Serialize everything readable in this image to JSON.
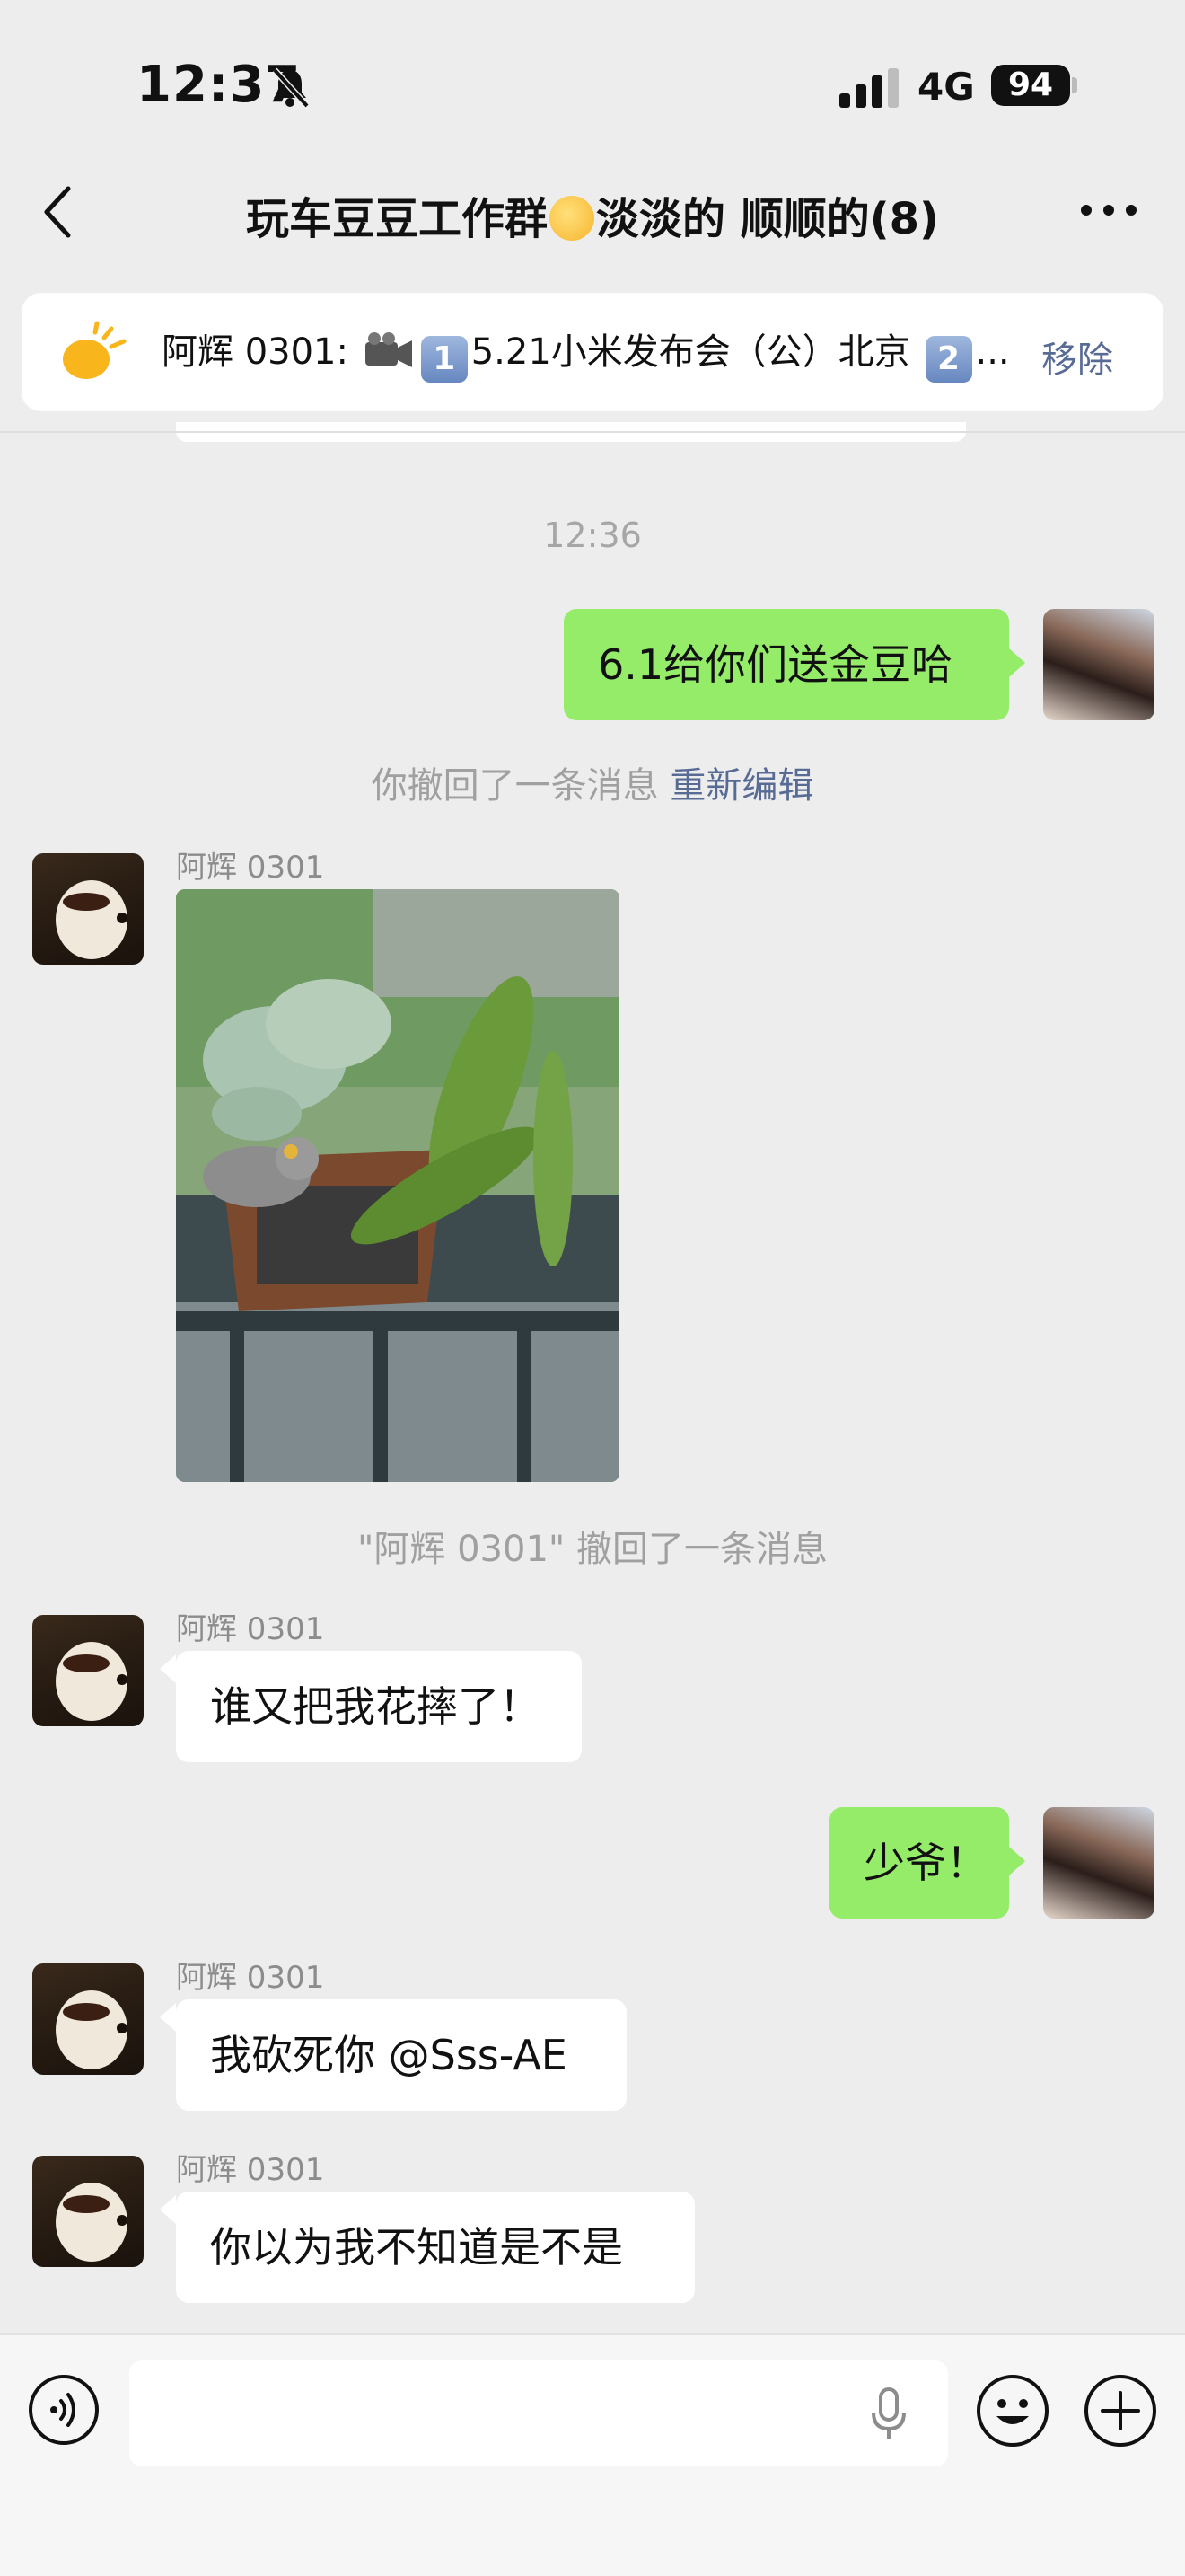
{
  "status_bar": {
    "time": "12:37",
    "network": "4G",
    "battery": "94",
    "icons": [
      "bell-slash-icon",
      "signal-bars-icon"
    ]
  },
  "header": {
    "title_part1": "玩车豆豆工作群",
    "title_part2": "淡淡的 顺顺的",
    "member_count": "(8)",
    "icons": [
      "chevron-left-icon",
      "sun-face-emoji",
      "more-dots-icon"
    ]
  },
  "pinned": {
    "sender": "阿辉 0301:",
    "badge1": "1",
    "text1": "5.21小米发布会（公）北京",
    "badge2": "2",
    "ellipsis": "...",
    "remove_label": "移除",
    "icons": [
      "sun-icon",
      "video-camera-icon"
    ]
  },
  "chat": {
    "timestamp": "12:36",
    "recall_self": "你撤回了一条消息",
    "reedit_label": "重新编辑",
    "recall_other": "\"阿辉 0301\" 撤回了一条消息",
    "messages": [
      {
        "sender": "",
        "text": "6.1给你们送金豆哈",
        "direction": "out"
      },
      {
        "sender": "阿辉 0301",
        "text": "",
        "direction": "in",
        "type": "image"
      },
      {
        "sender": "阿辉 0301",
        "text": "谁又把我花摔了！",
        "direction": "in"
      },
      {
        "sender": "",
        "text": "少爷！",
        "direction": "out"
      },
      {
        "sender": "阿辉 0301",
        "text": "我砍死你 @Sss-AE",
        "direction": "in"
      },
      {
        "sender": "阿辉 0301",
        "text": "你以为我不知道是不是",
        "direction": "in"
      }
    ]
  },
  "input_bar": {
    "placeholder": "",
    "icons": [
      "voice-icon",
      "microphone-icon",
      "emoji-icon",
      "plus-icon"
    ]
  },
  "colors": {
    "background": "#ededed",
    "outgoing_bubble": "#95ec69",
    "incoming_bubble": "#ffffff",
    "link": "#576b95"
  }
}
